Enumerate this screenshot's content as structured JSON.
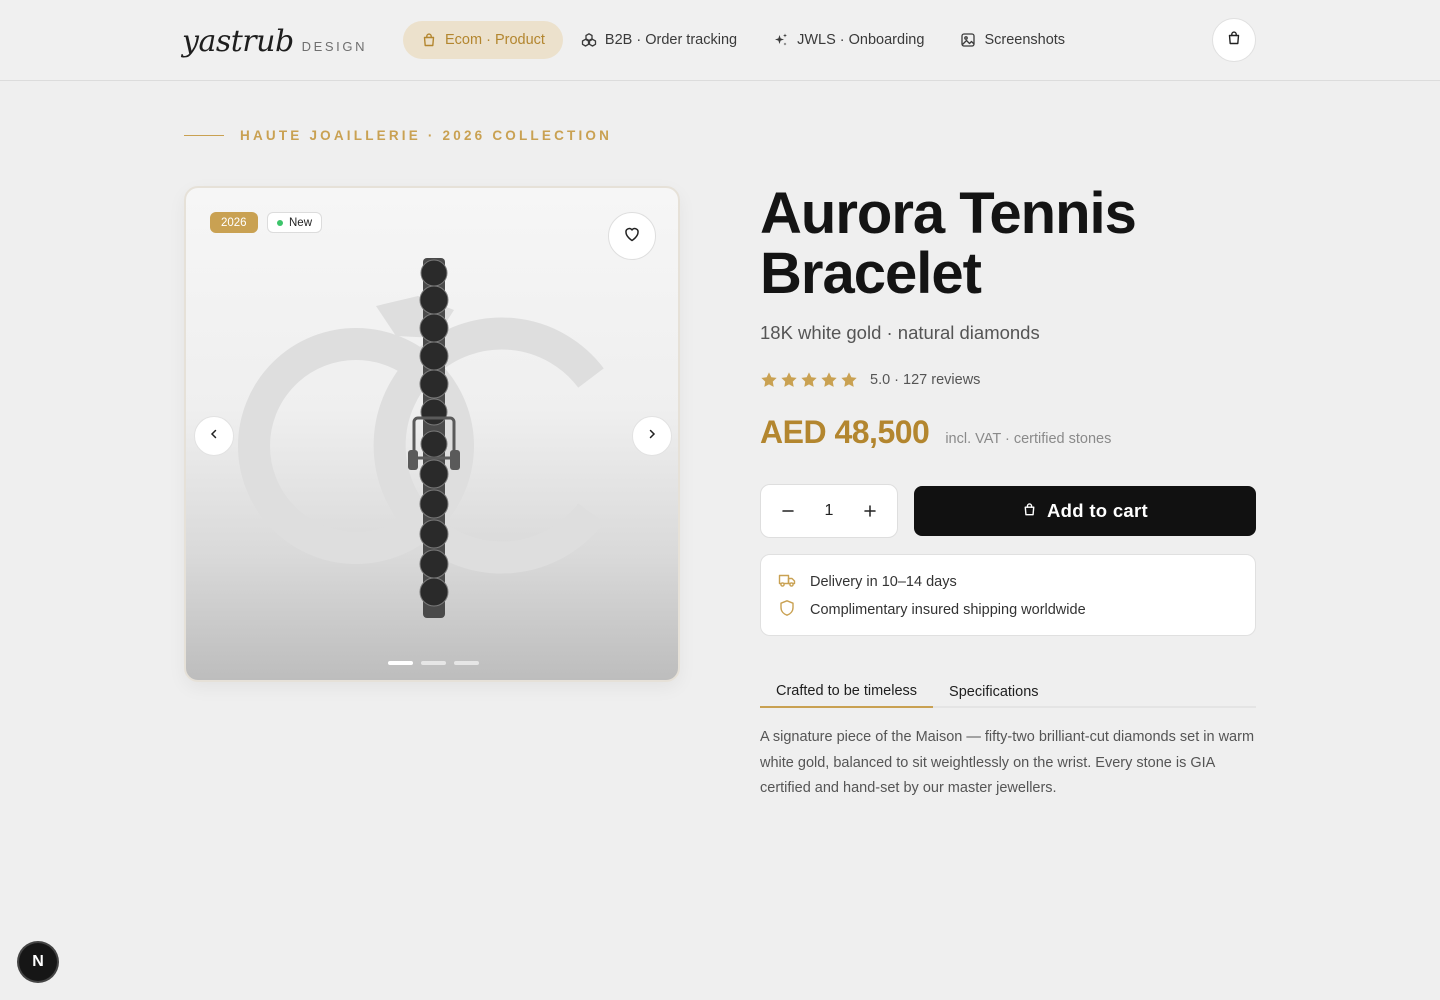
{
  "header": {
    "logo": "yastrub",
    "logo_sub": "DESIGN",
    "nav": [
      {
        "label": "Ecom · Product",
        "icon": "bag-icon",
        "active": true
      },
      {
        "label": "B2B · Order tracking",
        "icon": "boxes-icon",
        "active": false
      },
      {
        "label": "JWLS · Onboarding",
        "icon": "sparkles-icon",
        "active": false
      },
      {
        "label": "Screenshots",
        "icon": "image-icon",
        "active": false
      }
    ],
    "cart_icon": "shopping-bag-icon"
  },
  "eyebrow": "HAUTE JOAILLERIE · 2026 COLLECTION",
  "gallery": {
    "badge_year": "2026",
    "badge_new": "New",
    "slide_count": 3,
    "active_slide": 1
  },
  "product": {
    "title": "Aurora Tennis Bracelet",
    "subtitle": "18K white gold · natural diamonds",
    "stars": 5,
    "rating_text": "5.0 · 127 reviews",
    "price": "AED 48,500",
    "price_note": "incl. VAT · certified stones",
    "quantity": "1",
    "add_to_cart": "Add to cart"
  },
  "shipping": [
    {
      "icon": "truck-icon",
      "text": "Delivery in 10–14 days"
    },
    {
      "icon": "shield-icon",
      "text": "Complimentary insured shipping worldwide"
    }
  ],
  "tabs": [
    {
      "label": "Crafted to be timeless",
      "active": true
    },
    {
      "label": "Specifications",
      "active": false
    }
  ],
  "description": "A signature piece of the Maison — fifty-two brilliant-cut diamonds set in warm white gold, balanced to sit weightlessly on the wrist. Every stone is GIA certified and hand-set by our master jewellers.",
  "dev_badge": "N",
  "colors": {
    "accent": "#c9a152",
    "accent_dark": "#b3862f",
    "background": "#efefef",
    "button": "#111111"
  }
}
